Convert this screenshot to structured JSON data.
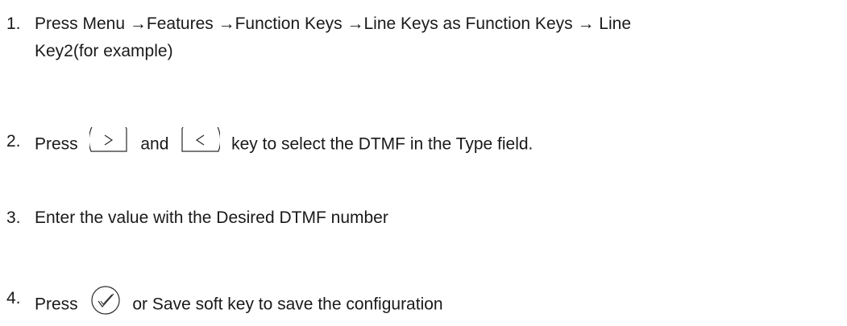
{
  "steps": [
    {
      "number": "1.",
      "text_line1": "Press Menu →Features →Function Keys →Line Keys as Function Keys → Line",
      "text_line2": "Key2(for example)"
    },
    {
      "number": "2.",
      "pre": "Press",
      "icon1": "right-arrow-key-icon",
      "mid": "and",
      "icon2": "left-arrow-key-icon",
      "post": "key to select the DTMF in the Type field."
    },
    {
      "number": "3.",
      "text": "Enter the value with the Desired DTMF number"
    },
    {
      "number": "4.",
      "pre": "Press",
      "icon": "ok-check-key-icon",
      "post": "or Save soft key to save the configuration"
    }
  ]
}
